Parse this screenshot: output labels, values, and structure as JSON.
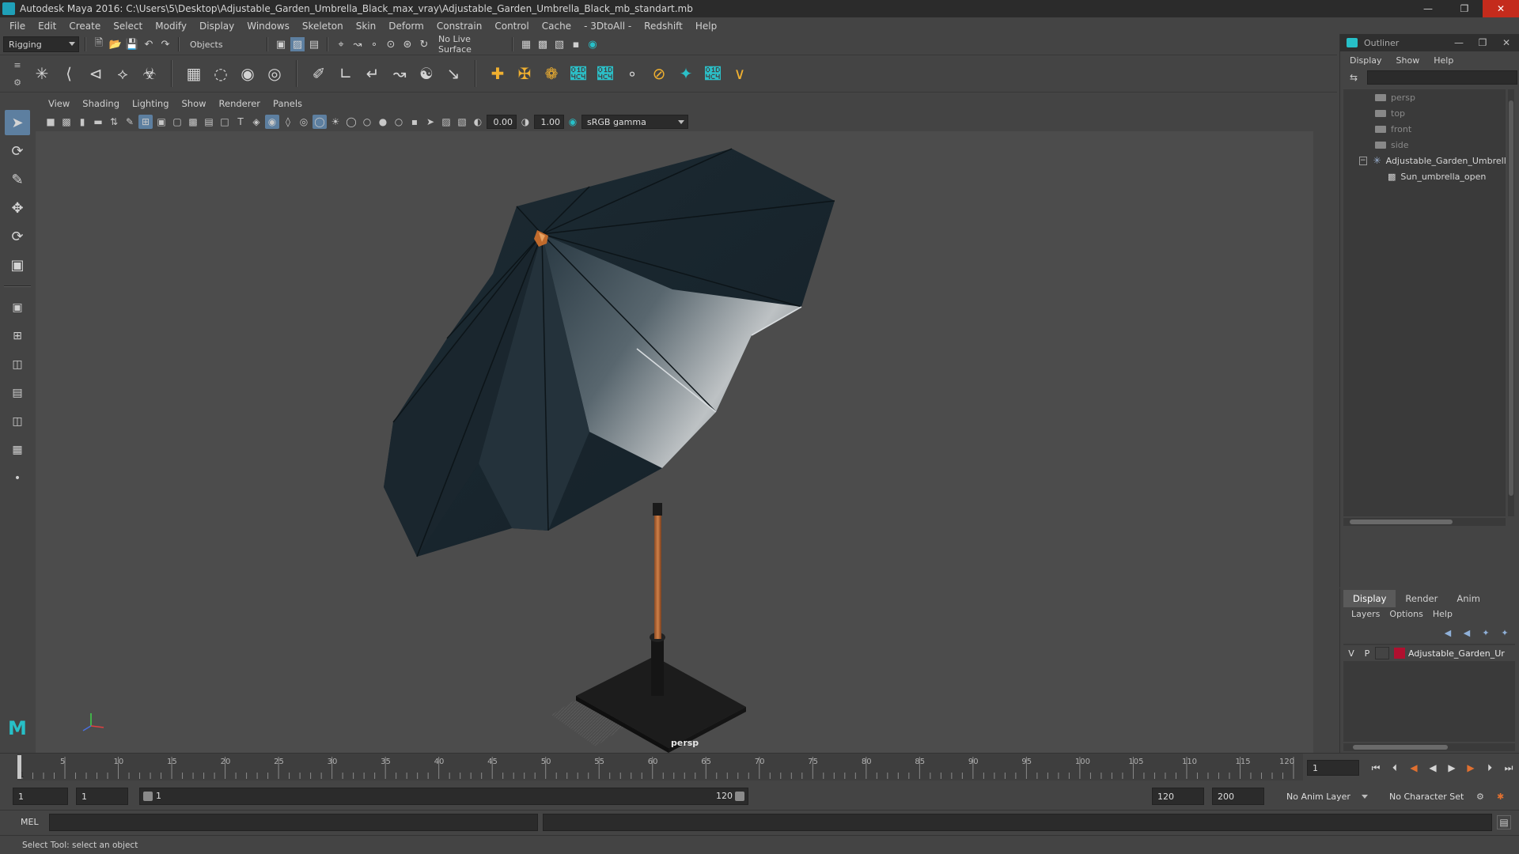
{
  "window": {
    "title": "Autodesk Maya 2016: C:\\Users\\5\\Desktop\\Adjustable_Garden_Umbrella_Black_max_vray\\Adjustable_Garden_Umbrella_Black_mb_standart.mb",
    "minimize": "—",
    "restore": "❐",
    "close": "✕"
  },
  "menubar": [
    "File",
    "Edit",
    "Create",
    "Select",
    "Modify",
    "Display",
    "Windows",
    "Skeleton",
    "Skin",
    "Deform",
    "Constrain",
    "Control",
    "Cache",
    "- 3DtoAll -",
    "Redshift",
    "Help"
  ],
  "statusline": {
    "menuset": "Rigging",
    "select_mode": "Objects",
    "live_surface": "No Live Surface"
  },
  "viewport": {
    "menu": [
      "View",
      "Shading",
      "Lighting",
      "Show",
      "Renderer",
      "Panels"
    ],
    "exposure": "0.00",
    "gamma": "1.00",
    "color_space": "sRGB gamma",
    "camera": "persp"
  },
  "outliner": {
    "title": "Outliner",
    "menu": [
      "Display",
      "Show",
      "Help"
    ],
    "items": [
      {
        "label": "persp",
        "type": "camera"
      },
      {
        "label": "top",
        "type": "camera"
      },
      {
        "label": "front",
        "type": "camera"
      },
      {
        "label": "side",
        "type": "camera"
      },
      {
        "label": "Adjustable_Garden_Umbrell",
        "type": "group",
        "expanded": true
      },
      {
        "label": "Sun_umbrella_open",
        "type": "mesh"
      }
    ]
  },
  "layer_editor": {
    "tabs": [
      "Display",
      "Render",
      "Anim"
    ],
    "active_tab": "Display",
    "menu": [
      "Layers",
      "Options",
      "Help"
    ],
    "layers": [
      {
        "visible": "V",
        "playback": "P",
        "name": "Adjustable_Garden_Ur",
        "color": "#b0102f"
      }
    ]
  },
  "timeslider": {
    "ticks": [
      "5",
      "10",
      "15",
      "20",
      "25",
      "30",
      "35",
      "40",
      "45",
      "50",
      "55",
      "60",
      "65",
      "70",
      "75",
      "80",
      "85",
      "90",
      "95",
      "100",
      "105",
      "110",
      "115",
      "120"
    ],
    "first": "1",
    "current_frame": "1"
  },
  "rangeslider": {
    "anim_start": "1",
    "playback_start": "1",
    "range_start_label": "1",
    "range_end_label": "120",
    "playback_end": "120",
    "anim_end": "200",
    "anim_layer": "No Anim Layer",
    "character_set": "No Character Set"
  },
  "cmdline": {
    "label": "MEL"
  },
  "helpline": {
    "text": "Select Tool: select an object"
  },
  "colors": {
    "accent": "#5d7fa0",
    "maya_teal": "#27c0c8",
    "close_red": "#c42b1c",
    "layer_red": "#b0102f"
  }
}
